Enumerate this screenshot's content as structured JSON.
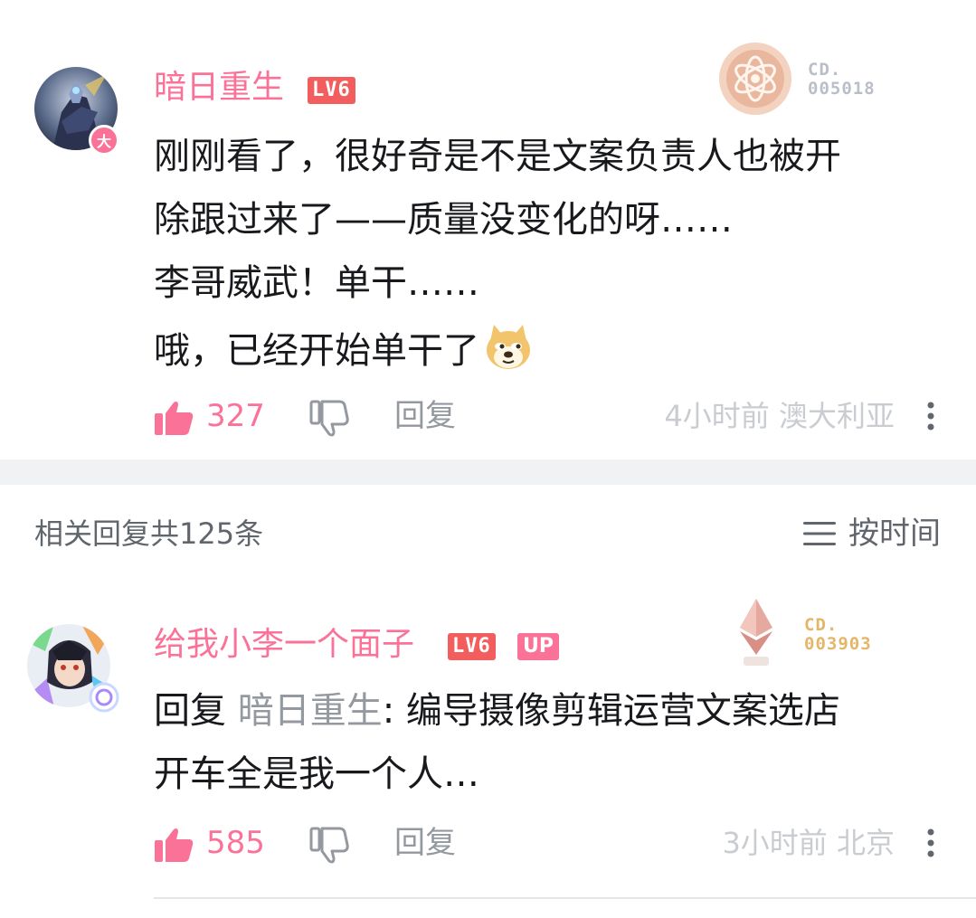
{
  "comments": [
    {
      "username": "暗日重生",
      "level": "LV6",
      "avatar_badge": "大",
      "medal_code_line1": "CD.",
      "medal_code_line2": "005018",
      "content_lines": [
        "刚刚看了，很好奇是不是文案负责人也被开",
        "除跟过来了——质量没变化的呀……",
        "李哥威武！单干……",
        "哦，已经开始单干了"
      ],
      "emoji": "doge-icon",
      "likes": "327",
      "reply_label": "回复",
      "time": "4小时前",
      "location": "澳大利亚"
    },
    {
      "username": "给我小李一个面子",
      "level": "LV6",
      "up_tag": "UP",
      "medal_code_line1": "CD.",
      "medal_code_line2": "003903",
      "reply_prefix": "回复",
      "reply_target": "暗日重生",
      "content_lines": [
        ": 编导摄像剪辑运营文案选店",
        "开车全是我一个人…"
      ],
      "likes": "585",
      "reply_label": "回复",
      "time": "3小时前",
      "location": "北京"
    }
  ],
  "sub_replies": {
    "count_label": "相关回复共125条",
    "sort_label": "按时间"
  },
  "colors": {
    "accent_pink": "#fb7299",
    "level_red": "#f25d5d",
    "muted_text": "#9499a0",
    "light_text": "#c9ccd0",
    "divider": "#f1f2f3",
    "medal_gold": "#e5b668"
  }
}
